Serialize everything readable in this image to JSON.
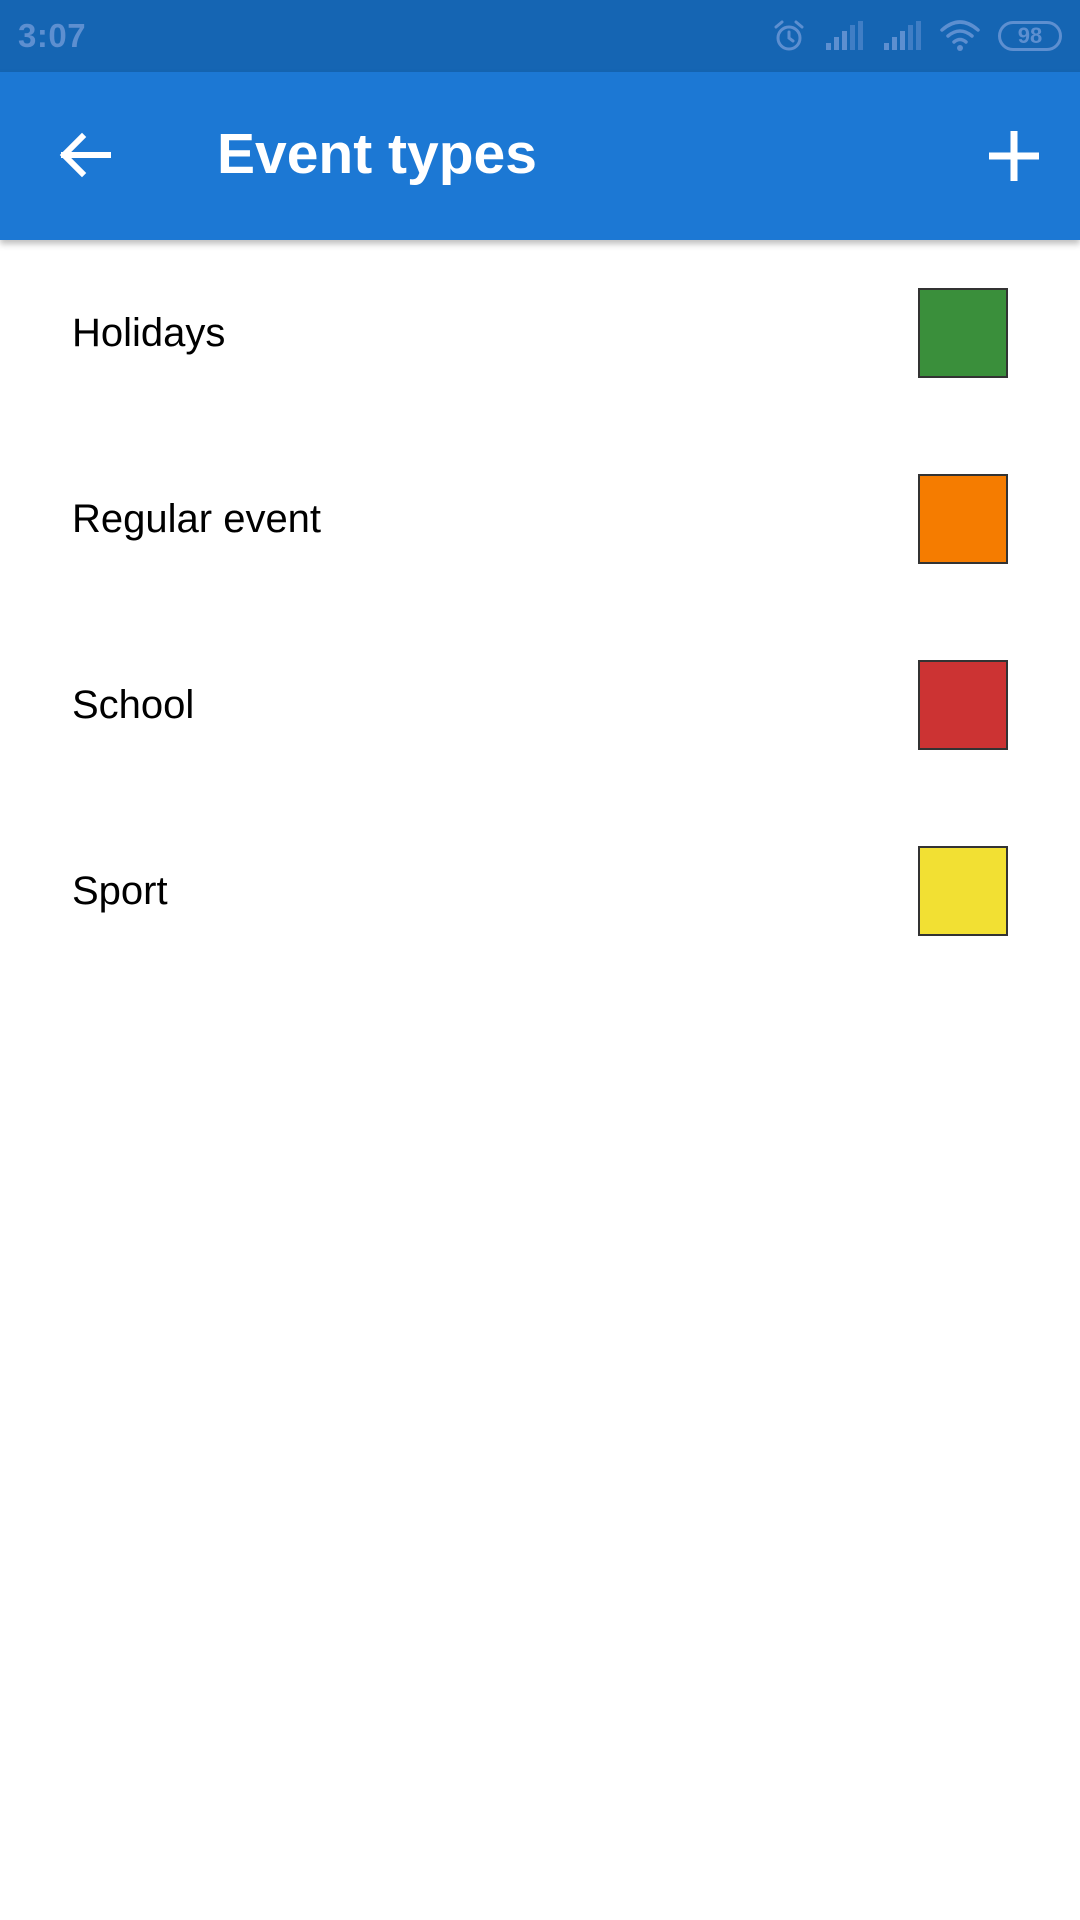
{
  "status_bar": {
    "time": "3:07",
    "battery": "98",
    "icons": [
      "alarm-icon",
      "signal-icon",
      "signal-icon",
      "wifi-icon",
      "battery-icon"
    ],
    "color": "#5d8fd0",
    "background": "#1565b3"
  },
  "app_bar": {
    "title": "Event types",
    "back_icon": "arrow-left-icon",
    "add_icon": "plus-icon",
    "background": "#1c78d4"
  },
  "event_types": [
    {
      "label": "Holidays",
      "color": "#3a8f3b"
    },
    {
      "label": "Regular event",
      "color": "#f57c00"
    },
    {
      "label": "School",
      "color": "#cc3333"
    },
    {
      "label": "Sport",
      "color": "#f2e033"
    }
  ]
}
